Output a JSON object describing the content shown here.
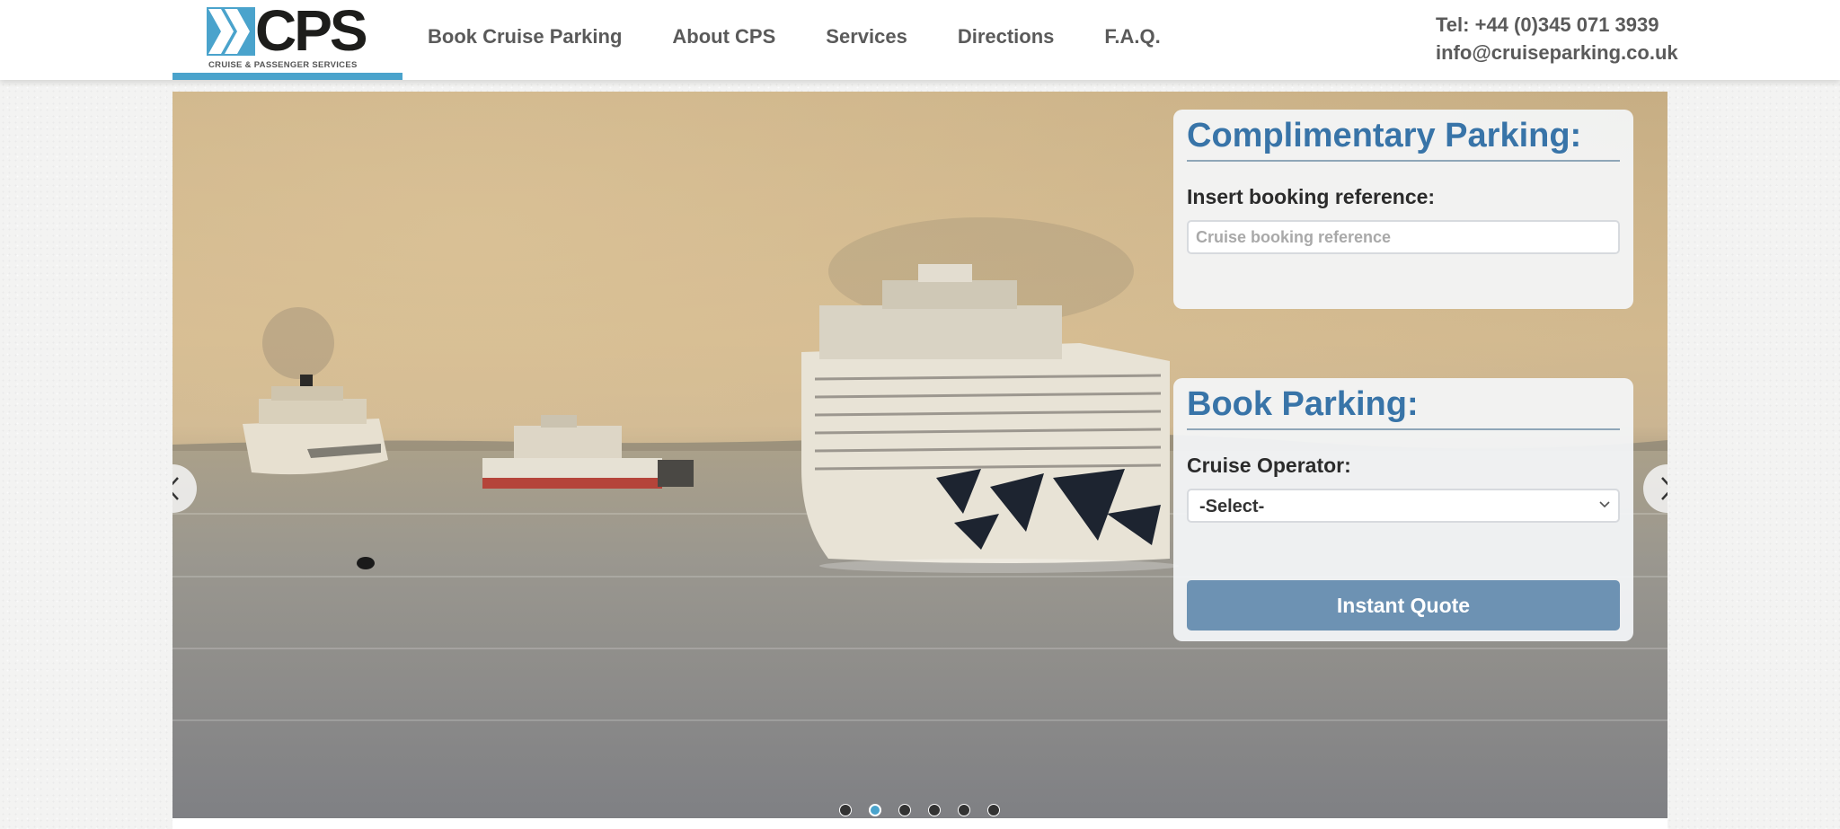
{
  "brand": {
    "logo_text": "CPS",
    "tagline": "CRUISE & PASSENGER SERVICES",
    "accent_color": "#4aa3cc"
  },
  "nav": {
    "items": [
      {
        "label": "Book Cruise Parking"
      },
      {
        "label": "About CPS"
      },
      {
        "label": "Services"
      },
      {
        "label": "Directions"
      },
      {
        "label": "F.A.Q."
      }
    ]
  },
  "contact": {
    "phone": "Tel: +44 (0)345 071 3939",
    "email": "info@cruiseparking.co.uk"
  },
  "complimentary": {
    "title": "Complimentary Parking:",
    "label": "Insert booking reference:",
    "placeholder": "Cruise booking reference",
    "value": ""
  },
  "booking": {
    "title": "Book Parking:",
    "operator_label": "Cruise Operator:",
    "operator_selected": "-Select-",
    "button_label": "Instant Quote",
    "button_color": "#6d92b3"
  },
  "carousel": {
    "slide_count": 6,
    "active_slide": 2,
    "prev_icon": "chevron-left-icon",
    "next_icon": "chevron-right-icon"
  },
  "colors": {
    "title_blue": "#3874a8",
    "nav_text": "#5a5a5a"
  }
}
